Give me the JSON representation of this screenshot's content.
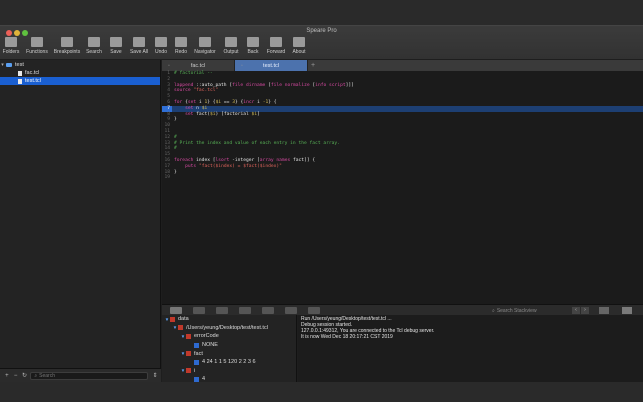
{
  "window": {
    "title": "Speare Pro"
  },
  "toolbar": {
    "items": [
      {
        "label": "Folders",
        "icon": "folder-icon"
      },
      {
        "label": "Functions",
        "icon": "functions-icon"
      },
      {
        "label": "Breakpoints",
        "icon": "breakpoints-icon"
      },
      {
        "label": "Search",
        "icon": "search-icon"
      },
      {
        "label": "Save",
        "icon": "save-icon"
      },
      {
        "label": "Save All",
        "icon": "save-all-icon"
      },
      {
        "label": "Undo",
        "icon": "undo-icon"
      },
      {
        "label": "Redo",
        "icon": "redo-icon"
      },
      {
        "label": "Navigator",
        "icon": "navigator-icon"
      },
      {
        "label": "Output",
        "icon": "output-icon"
      },
      {
        "label": "Back",
        "icon": "back-icon"
      },
      {
        "label": "Forward",
        "icon": "forward-icon"
      },
      {
        "label": "About",
        "icon": "about-icon"
      }
    ]
  },
  "sidebar": {
    "folder": "test",
    "files": [
      "fac.tcl",
      "test.tcl"
    ],
    "selected_file": "test.tcl",
    "search_placeholder": "Search"
  },
  "tabs": [
    {
      "label": "fac.tcl",
      "active": false
    },
    {
      "label": "test.tcl",
      "active": true
    }
  ],
  "editor": {
    "highlighted_line": 7,
    "lines": [
      {
        "n": "1",
        "segments": [
          {
            "c": "cm",
            "t": "# factorial --"
          }
        ]
      },
      {
        "n": "2",
        "segments": []
      },
      {
        "n": "3",
        "segments": [
          {
            "c": "kw",
            "t": "lappend"
          },
          {
            "c": "plain",
            "t": " ::auto_path "
          },
          {
            "c": "brk",
            "t": "["
          },
          {
            "c": "kw",
            "t": "file dirname"
          },
          {
            "c": "plain",
            "t": " "
          },
          {
            "c": "brk",
            "t": "["
          },
          {
            "c": "kw",
            "t": "file normalize"
          },
          {
            "c": "plain",
            "t": " "
          },
          {
            "c": "brk",
            "t": "["
          },
          {
            "c": "kw",
            "t": "info script"
          },
          {
            "c": "brk",
            "t": "]]]"
          }
        ]
      },
      {
        "n": "4",
        "segments": [
          {
            "c": "kw",
            "t": "source"
          },
          {
            "c": "plain",
            "t": " "
          },
          {
            "c": "str",
            "t": "\"fac.tcl\""
          }
        ]
      },
      {
        "n": "5",
        "segments": []
      },
      {
        "n": "6",
        "segments": [
          {
            "c": "kw",
            "t": "for"
          },
          {
            "c": "plain",
            "t": " {"
          },
          {
            "c": "kw",
            "t": "set"
          },
          {
            "c": "plain",
            "t": " i "
          },
          {
            "c": "var",
            "t": "1"
          },
          {
            "c": "plain",
            "t": "} {"
          },
          {
            "c": "var",
            "t": "$i"
          },
          {
            "c": "plain",
            "t": " == "
          },
          {
            "c": "var",
            "t": "3"
          },
          {
            "c": "plain",
            "t": "} {"
          },
          {
            "c": "kw",
            "t": "incr"
          },
          {
            "c": "plain",
            "t": " i "
          },
          {
            "c": "var",
            "t": "-1"
          },
          {
            "c": "plain",
            "t": "} {"
          }
        ]
      },
      {
        "n": "7",
        "segments": [
          {
            "c": "plain",
            "t": "    "
          },
          {
            "c": "kw",
            "t": "set"
          },
          {
            "c": "plain",
            "t": " n "
          },
          {
            "c": "var",
            "t": "$i"
          }
        ]
      },
      {
        "n": "8",
        "segments": [
          {
            "c": "plain",
            "t": "    "
          },
          {
            "c": "kw",
            "t": "set"
          },
          {
            "c": "plain",
            "t": " fact("
          },
          {
            "c": "var",
            "t": "$i"
          },
          {
            "c": "plain",
            "t": ") ["
          },
          {
            "c": "fn",
            "t": "factorial"
          },
          {
            "c": "plain",
            "t": " "
          },
          {
            "c": "var",
            "t": "$i"
          },
          {
            "c": "plain",
            "t": "]"
          }
        ]
      },
      {
        "n": "9",
        "segments": [
          {
            "c": "plain",
            "t": "}"
          }
        ]
      },
      {
        "n": "10",
        "segments": []
      },
      {
        "n": "11",
        "segments": []
      },
      {
        "n": "12",
        "segments": [
          {
            "c": "cm",
            "t": "#"
          }
        ]
      },
      {
        "n": "13",
        "segments": [
          {
            "c": "cm",
            "t": "# Print the index and value of each entry in the fact array."
          }
        ]
      },
      {
        "n": "14",
        "segments": [
          {
            "c": "cm",
            "t": "#"
          }
        ]
      },
      {
        "n": "15",
        "segments": []
      },
      {
        "n": "16",
        "segments": [
          {
            "c": "kw",
            "t": "foreach"
          },
          {
            "c": "plain",
            "t": " index ["
          },
          {
            "c": "kw",
            "t": "lsort"
          },
          {
            "c": "plain",
            "t": " -integer ["
          },
          {
            "c": "kw",
            "t": "array names"
          },
          {
            "c": "plain",
            "t": " fact]] {"
          }
        ]
      },
      {
        "n": "17",
        "segments": [
          {
            "c": "plain",
            "t": "    "
          },
          {
            "c": "kw",
            "t": "puts"
          },
          {
            "c": "plain",
            "t": " "
          },
          {
            "c": "str",
            "t": "\"fact($index) = $fact($index)\""
          }
        ]
      },
      {
        "n": "18",
        "segments": [
          {
            "c": "plain",
            "t": "}"
          }
        ]
      },
      {
        "n": "19",
        "segments": []
      }
    ]
  },
  "debug": {
    "search_placeholder": "Search Stackview",
    "variables": [
      {
        "indent": 0,
        "open": true,
        "color": "red",
        "label": "data"
      },
      {
        "indent": 1,
        "open": true,
        "color": "red",
        "label": "/Users/yeung/Desktop/test/test.tcl"
      },
      {
        "indent": 2,
        "open": true,
        "color": "red",
        "label": "errorCode"
      },
      {
        "indent": 3,
        "open": false,
        "color": "blue",
        "label": "NONE"
      },
      {
        "indent": 2,
        "open": true,
        "color": "red",
        "label": "fact"
      },
      {
        "indent": 3,
        "open": false,
        "color": "blue",
        "label": "4 24 1 1 5 120 2 2 3 6"
      },
      {
        "indent": 2,
        "open": true,
        "color": "red",
        "label": "i"
      },
      {
        "indent": 3,
        "open": false,
        "color": "blue",
        "label": "4"
      },
      {
        "indent": 2,
        "open": true,
        "color": "red",
        "label": "n"
      },
      {
        "indent": 3,
        "open": false,
        "color": "blue",
        "label": "1"
      }
    ],
    "console": [
      "Run /Users/yeung/Desktop/test/test.tcl ...",
      "Debug session started.",
      "127.0.0.1:49312, You are connected to the Tcl debug server.",
      "It is now Wed Dec 18 20:17:21 CST 2019"
    ]
  },
  "colors": {
    "selection": "#1a5fd1",
    "active_tab": "#4c72ad",
    "keyword": "#d94aa3",
    "string": "#e0645c",
    "comment": "#58b156"
  }
}
